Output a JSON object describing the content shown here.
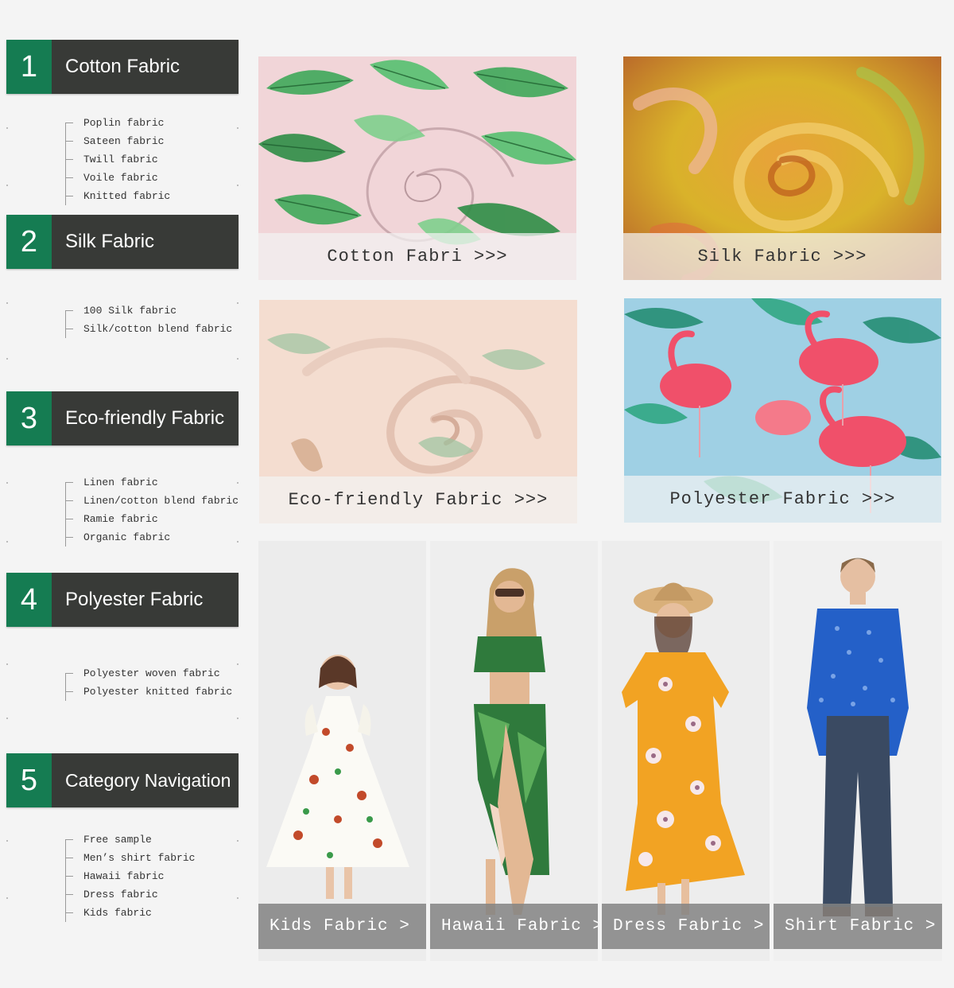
{
  "sections": [
    {
      "number": "1",
      "title": "Cotton Fabric",
      "items": [
        "Poplin fabric",
        "Sateen fabric",
        "Twill fabric",
        "Voile fabric",
        "Knitted fabric"
      ]
    },
    {
      "number": "2",
      "title": "Silk Fabric",
      "items": [
        "100 Silk fabric",
        "Silk/cotton blend fabric"
      ]
    },
    {
      "number": "3",
      "title": "Eco-friendly Fabric",
      "items": [
        "Linen fabric",
        "Linen/cotton blend fabric",
        "Ramie fabric",
        "Organic fabric"
      ]
    },
    {
      "number": "4",
      "title": "Polyester Fabric",
      "items": [
        "Polyester woven fabric",
        "Polyester knitted fabric"
      ]
    },
    {
      "number": "5",
      "title": "Category Navigation",
      "items": [
        "Free sample",
        "Men’s shirt fabric",
        "Hawaii fabric",
        "Dress fabric",
        "Kids fabric"
      ]
    }
  ],
  "tiles": [
    {
      "label": "Cotton Fabri >>>",
      "image": "green tropical leaf print on pink cotton, swirled"
    },
    {
      "label": "Silk Fabric >>>",
      "image": "yellow and orange leaf print silk, swirled"
    },
    {
      "label": "Eco-friendly Fabric >>>",
      "image": "pale pink linen with watercolor leaves, swirled"
    },
    {
      "label": "Polyester Fabric >>>",
      "image": "pink flamingos and teal palm leaves on light blue"
    }
  ],
  "models": [
    {
      "label": "Kids Fabric >",
      "image": "girl in white floral dress"
    },
    {
      "label": "Hawaii Fabric >",
      "image": "woman in green palm leaf print set"
    },
    {
      "label": "Dress Fabric >",
      "image": "woman in orange floral wrap dress with straw hat"
    },
    {
      "label": "Shirt Fabric >",
      "image": "man in blue patterned shirt and jeans"
    }
  ],
  "colors": {
    "accent_green": "#157c52",
    "header_dark": "#383a37",
    "background": "#f4f4f4"
  }
}
